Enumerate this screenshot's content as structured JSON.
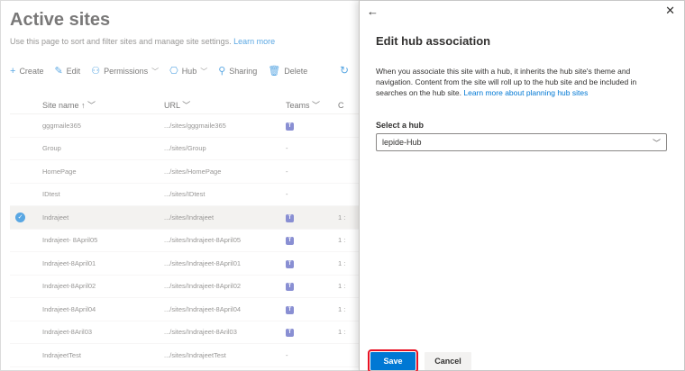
{
  "page": {
    "title": "Active sites",
    "description": "Use this page to sort and filter sites and manage site settings.",
    "learn_more": "Learn more"
  },
  "toolbar": {
    "create": "Create",
    "edit": "Edit",
    "permissions": "Permissions",
    "hub": "Hub",
    "sharing": "Sharing",
    "delete": "Delete"
  },
  "grid": {
    "headers": {
      "name": "Site name ↑",
      "url": "URL",
      "teams": "Teams",
      "c": "C"
    },
    "rows": [
      {
        "name": "gggmaile365",
        "url": ".../sites/gggmaile365",
        "teams": "teams",
        "c": ""
      },
      {
        "name": "Group",
        "url": ".../sites/Group",
        "teams": "-",
        "c": ""
      },
      {
        "name": "HomePage",
        "url": ".../sites/HomePage",
        "teams": "-",
        "c": ""
      },
      {
        "name": "IDtest",
        "url": ".../sites/IDtest",
        "teams": "-",
        "c": ""
      },
      {
        "name": "Indrajeet",
        "url": ".../sites/Indrajeet",
        "teams": "teams",
        "c": "1 :"
      },
      {
        "name": "Indrajeet- 8April05",
        "url": ".../sites/Indrajeet-8April05",
        "teams": "teams",
        "c": "1 :"
      },
      {
        "name": "Indrajeet-8April01",
        "url": ".../sites/Indrajeet-8April01",
        "teams": "teams",
        "c": "1 :"
      },
      {
        "name": "Indrajeet-8April02",
        "url": ".../sites/Indrajeet-8April02",
        "teams": "teams",
        "c": "1 :"
      },
      {
        "name": "Indrajeet-8April04",
        "url": ".../sites/Indrajeet-8April04",
        "teams": "teams",
        "c": "1 :"
      },
      {
        "name": "Indrajeet-8Aril03",
        "url": ".../sites/Indrajeet-8Aril03",
        "teams": "teams",
        "c": "1 :"
      },
      {
        "name": "IndrajeetTest",
        "url": ".../sites/IndrajeetTest",
        "teams": "-",
        "c": ""
      }
    ]
  },
  "panel": {
    "title": "Edit hub association",
    "description": "When you associate this site with a hub, it inherits the hub site's theme and navigation. Content from the site will roll up to the hub site and be included in searches on the hub site.",
    "learn_more": "Learn more about planning hub sites",
    "select_label": "Select a hub",
    "selected_hub": "lepide-Hub",
    "save": "Save",
    "cancel": "Cancel"
  },
  "colors": {
    "accent": "#0078d4",
    "highlight": "#e81123"
  }
}
